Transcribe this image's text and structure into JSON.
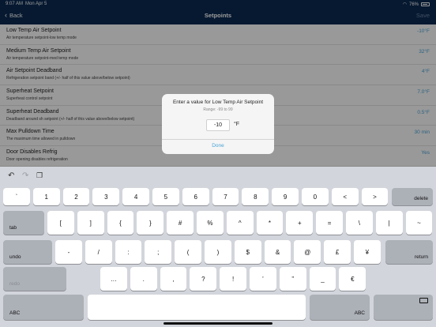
{
  "status": {
    "time": "9:07 AM",
    "date": "Mon Apr 5",
    "battery": "76%"
  },
  "nav": {
    "back_label": "Back",
    "title": "Setpoints",
    "save_label": "Save"
  },
  "rows": [
    {
      "title": "Low Temp Air Setpoint",
      "subtitle": "Air temperature setpoint-low temp mode",
      "value": "-10°F"
    },
    {
      "title": "Medium Temp Air Setpoint",
      "subtitle": "Air temperature setpoint-med temp mode",
      "value": "32°F"
    },
    {
      "title": "Air Setpoint Deadband",
      "subtitle": "Refrigeration setpoint band (+/- half of this value above/below setpoint)",
      "value": "4°F"
    },
    {
      "title": "Superheat Setpoint",
      "subtitle": "Superheat control setpoint",
      "value": "7.0°F"
    },
    {
      "title": "Superheat Deadband",
      "subtitle": "Deadband around sh setpoint (+/- half of this value above/below setpoint)",
      "value": "0.5°F"
    },
    {
      "title": "Max Pulldown Time",
      "subtitle": "The maximum time allowed in pulldown",
      "value": "30 min"
    },
    {
      "title": "Door Disables Refrig",
      "subtitle": "Door opening disables refrigeration",
      "value": "Yes"
    }
  ],
  "dialog": {
    "title": "Enter a value for Low Temp Air Setpoint",
    "range": "Range: -99 to 99",
    "input_value": "-10",
    "unit": "°F",
    "done_label": "Done"
  },
  "keyboard": {
    "row1": [
      "`",
      "1",
      "2",
      "3",
      "4",
      "5",
      "6",
      "7",
      "8",
      "9",
      "0",
      "<",
      ">"
    ],
    "delete_label": "delete",
    "tab_label": "tab",
    "row2": [
      "[",
      "]",
      "{",
      "}",
      "#",
      "%",
      "^",
      "*",
      "+",
      "=",
      "\\",
      "|",
      "~"
    ],
    "undo_label": "undo",
    "row3": [
      "-",
      "/",
      ":",
      ";",
      "(",
      ")",
      "$",
      "&",
      "@",
      "£",
      "¥"
    ],
    "return_label": "return",
    "redo_label": "redo",
    "row4": [
      "…",
      ".",
      ",",
      "?",
      "!",
      "’",
      "”",
      "_",
      "€"
    ],
    "abc_left_label": "ABC",
    "abc_right_label": "ABC"
  }
}
